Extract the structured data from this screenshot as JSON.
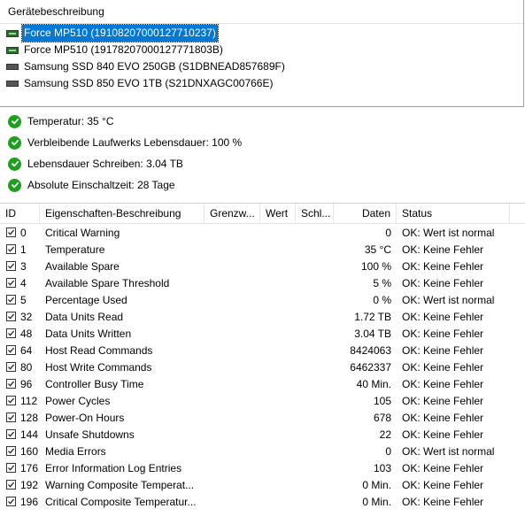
{
  "devices": {
    "header": "Gerätebeschreibung",
    "items": [
      {
        "label": "Force MP510 (19108207000127710237)",
        "icon": "nvme-drive-icon",
        "selected": true
      },
      {
        "label": "Force MP510 (19178207000127771803B)",
        "icon": "nvme-drive-icon",
        "selected": false
      },
      {
        "label": "Samsung SSD 840 EVO 250GB (S1DBNEAD857689F)",
        "icon": "sata-drive-icon",
        "selected": false
      },
      {
        "label": "Samsung SSD 850 EVO 1TB (S21DNXAGC00766E)",
        "icon": "sata-drive-icon",
        "selected": false
      }
    ]
  },
  "status": [
    "Temperatur: 35 °C",
    "Verbleibende Laufwerks Lebensdauer: 100 %",
    "Lebensdauer Schreiben: 3.04 TB",
    "Absolute Einschaltzeit: 28 Tage"
  ],
  "table": {
    "headers": [
      "ID",
      "Eigenschaften-Beschreibung",
      "Grenzw...",
      "Wert",
      "Schl...",
      "Daten",
      "Status"
    ],
    "rows": [
      {
        "id": "0",
        "desc": "Critical Warning",
        "daten": "0",
        "status": "OK: Wert ist normal"
      },
      {
        "id": "1",
        "desc": "Temperature",
        "daten": "35 °C",
        "status": "OK: Keine Fehler"
      },
      {
        "id": "3",
        "desc": "Available Spare",
        "daten": "100 %",
        "status": "OK: Keine Fehler"
      },
      {
        "id": "4",
        "desc": "Available Spare Threshold",
        "daten": "5 %",
        "status": "OK: Keine Fehler"
      },
      {
        "id": "5",
        "desc": "Percentage Used",
        "daten": "0 %",
        "status": "OK: Wert ist normal"
      },
      {
        "id": "32",
        "desc": "Data Units Read",
        "daten": "1.72 TB",
        "status": "OK: Keine Fehler"
      },
      {
        "id": "48",
        "desc": "Data Units Written",
        "daten": "3.04 TB",
        "status": "OK: Keine Fehler"
      },
      {
        "id": "64",
        "desc": "Host Read Commands",
        "daten": "8424063",
        "status": "OK: Keine Fehler"
      },
      {
        "id": "80",
        "desc": "Host Write Commands",
        "daten": "6462337",
        "status": "OK: Keine Fehler"
      },
      {
        "id": "96",
        "desc": "Controller Busy Time",
        "daten": "40 Min.",
        "status": "OK: Keine Fehler"
      },
      {
        "id": "112",
        "desc": "Power Cycles",
        "daten": "105",
        "status": "OK: Keine Fehler"
      },
      {
        "id": "128",
        "desc": "Power-On Hours",
        "daten": "678",
        "status": "OK: Keine Fehler"
      },
      {
        "id": "144",
        "desc": "Unsafe Shutdowns",
        "daten": "22",
        "status": "OK: Keine Fehler"
      },
      {
        "id": "160",
        "desc": "Media Errors",
        "daten": "0",
        "status": "OK: Wert ist normal"
      },
      {
        "id": "176",
        "desc": "Error Information Log Entries",
        "daten": "103",
        "status": "OK: Keine Fehler"
      },
      {
        "id": "192",
        "desc": "Warning Composite Temperat...",
        "daten": "0 Min.",
        "status": "OK: Keine Fehler"
      },
      {
        "id": "196",
        "desc": "Critical Composite Temperatur...",
        "daten": "0 Min.",
        "status": "OK: Keine Fehler"
      }
    ]
  },
  "colors": {
    "selection": "#0078d7",
    "ok_green": "#1aa01a"
  }
}
